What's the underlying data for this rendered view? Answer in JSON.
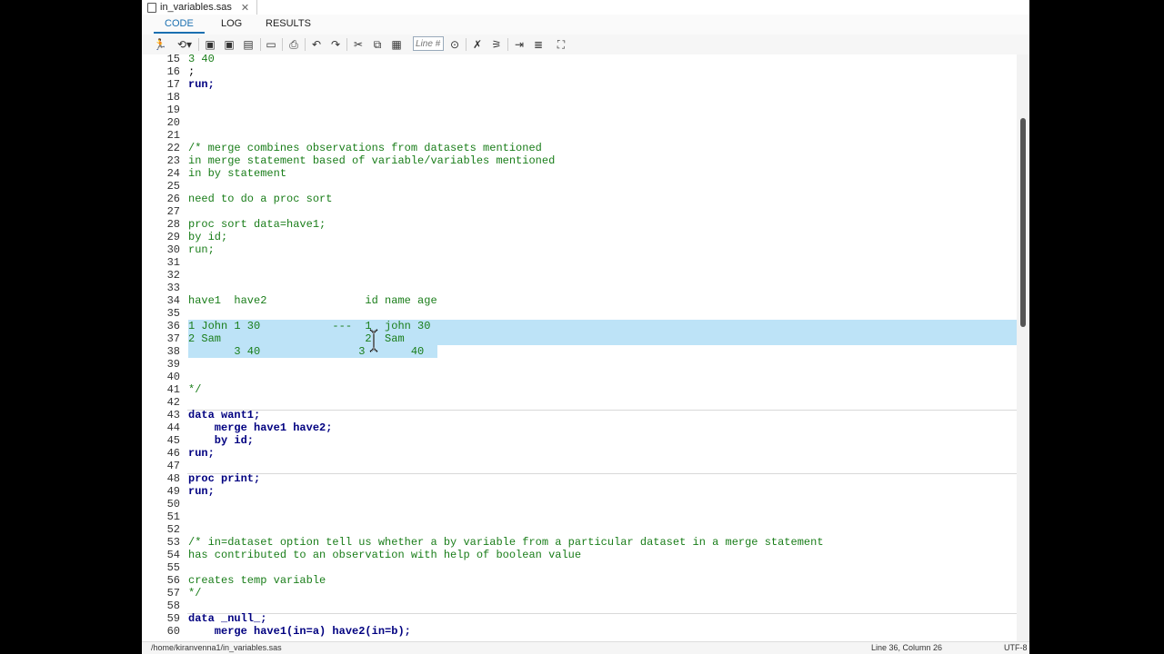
{
  "file_tab": {
    "name": "in_variables.sas",
    "close": "✕"
  },
  "tabs": {
    "code": "CODE",
    "log": "LOG",
    "results": "RESULTS"
  },
  "toolbar": {
    "line_placeholder": "Line #"
  },
  "editor": {
    "lines": [
      {
        "n": "15",
        "t": "3 40",
        "c": "cm"
      },
      {
        "n": "16",
        "t": ";",
        "c": ""
      },
      {
        "n": "17",
        "t": "run;",
        "c": "kw"
      },
      {
        "n": "18",
        "t": "",
        "c": ""
      },
      {
        "n": "19",
        "t": "",
        "c": ""
      },
      {
        "n": "20",
        "t": "",
        "c": ""
      },
      {
        "n": "21",
        "t": "",
        "c": ""
      },
      {
        "n": "22",
        "t": "/* merge combines observations from datasets mentioned",
        "c": "cm"
      },
      {
        "n": "23",
        "t": "in merge statement based of variable/variables mentioned",
        "c": "cm"
      },
      {
        "n": "24",
        "t": "in by statement",
        "c": "cm"
      },
      {
        "n": "25",
        "t": "",
        "c": ""
      },
      {
        "n": "26",
        "t": "need to do a proc sort",
        "c": "cm"
      },
      {
        "n": "27",
        "t": "",
        "c": ""
      },
      {
        "n": "28",
        "t": "proc sort data=have1;",
        "c": "cm"
      },
      {
        "n": "29",
        "t": "by id;",
        "c": "cm"
      },
      {
        "n": "30",
        "t": "run;",
        "c": "cm"
      },
      {
        "n": "31",
        "t": "",
        "c": ""
      },
      {
        "n": "32",
        "t": "",
        "c": ""
      },
      {
        "n": "33",
        "t": "",
        "c": ""
      },
      {
        "n": "34",
        "t": "have1  have2               id name age",
        "c": "cm"
      },
      {
        "n": "35",
        "t": "",
        "c": ""
      },
      {
        "n": "36",
        "t": "1 John 1 30           ---  1  john 30",
        "c": "cm"
      },
      {
        "n": "37",
        "t": "2 Sam                      2  Sam",
        "c": "cm"
      },
      {
        "n": "38",
        "t": "       3 40               3       40",
        "c": "cm"
      },
      {
        "n": "39",
        "t": "",
        "c": ""
      },
      {
        "n": "40",
        "t": "",
        "c": ""
      },
      {
        "n": "41",
        "t": "*/",
        "c": "cm"
      },
      {
        "n": "42",
        "t": "",
        "c": ""
      },
      {
        "n": "43",
        "t": "data want1;",
        "c": "kw"
      },
      {
        "n": "44",
        "t": "    merge have1 have2;",
        "c": "kw"
      },
      {
        "n": "45",
        "t": "    by id;",
        "c": "kw"
      },
      {
        "n": "46",
        "t": "run;",
        "c": "kw"
      },
      {
        "n": "47",
        "t": "",
        "c": ""
      },
      {
        "n": "48",
        "t": "proc print;",
        "c": "kw"
      },
      {
        "n": "49",
        "t": "run;",
        "c": "kw"
      },
      {
        "n": "50",
        "t": "",
        "c": ""
      },
      {
        "n": "51",
        "t": "",
        "c": ""
      },
      {
        "n": "52",
        "t": "",
        "c": ""
      },
      {
        "n": "53",
        "t": "/* in=dataset option tell us whether a by variable from a particular dataset in a merge statement",
        "c": "cm"
      },
      {
        "n": "54",
        "t": "has contributed to an observation with help of boolean value",
        "c": "cm"
      },
      {
        "n": "55",
        "t": "",
        "c": ""
      },
      {
        "n": "56",
        "t": "creates temp variable",
        "c": "cm"
      },
      {
        "n": "57",
        "t": "*/",
        "c": "cm"
      },
      {
        "n": "58",
        "t": "",
        "c": ""
      },
      {
        "n": "59",
        "t": "data _null_;",
        "c": "kw"
      },
      {
        "n": "60",
        "t": "    merge have1(in=a) have2(in=b);",
        "c": "kw"
      }
    ]
  },
  "status": {
    "path": "/home/kiranvenna1/in_variables.sas",
    "position": "Line 36, Column 26",
    "encoding": "UTF-8"
  }
}
